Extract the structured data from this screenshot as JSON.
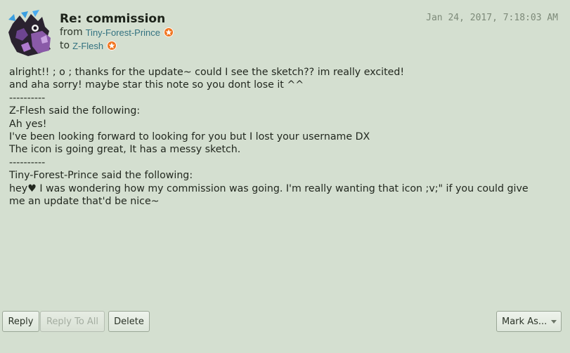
{
  "message": {
    "subject": "Re: commission",
    "from_prefix": "from",
    "from_user": "Tiny-Forest-Prince",
    "to_prefix": "to",
    "to_user": "Z-Flesh",
    "timestamp": "Jan 24, 2017, 7:18:03 AM",
    "lines": [
      "alright!! ; o ; thanks for the update~ could I see the sketch?? im really excited!",
      "",
      "and aha sorry! maybe star this note so you dont lose it ^^",
      "",
      "",
      "----------",
      "Z-Flesh said the following:",
      "",
      "Ah yes!",
      "I've been looking forward to looking for you but I lost your username DX",
      "",
      "The icon is going great, It has a messy sketch.",
      "",
      "",
      "----------",
      "Tiny-Forest-Prince said the following:",
      "",
      "hey♥ I was wondering how my commission was going. I'm really wanting that icon ;v;\" if you could give",
      "me an update that'd be nice~"
    ]
  },
  "actions": {
    "reply": "Reply",
    "reply_all": "Reply To All",
    "delete": "Delete",
    "mark_as": "Mark As..."
  },
  "colors": {
    "background": "#d4dfd0",
    "link": "#337280",
    "badge": "#f0741f"
  },
  "icons": {
    "avatar": "user-avatar",
    "badge": "member-badge-icon",
    "dropdown": "chevron-down-icon"
  }
}
